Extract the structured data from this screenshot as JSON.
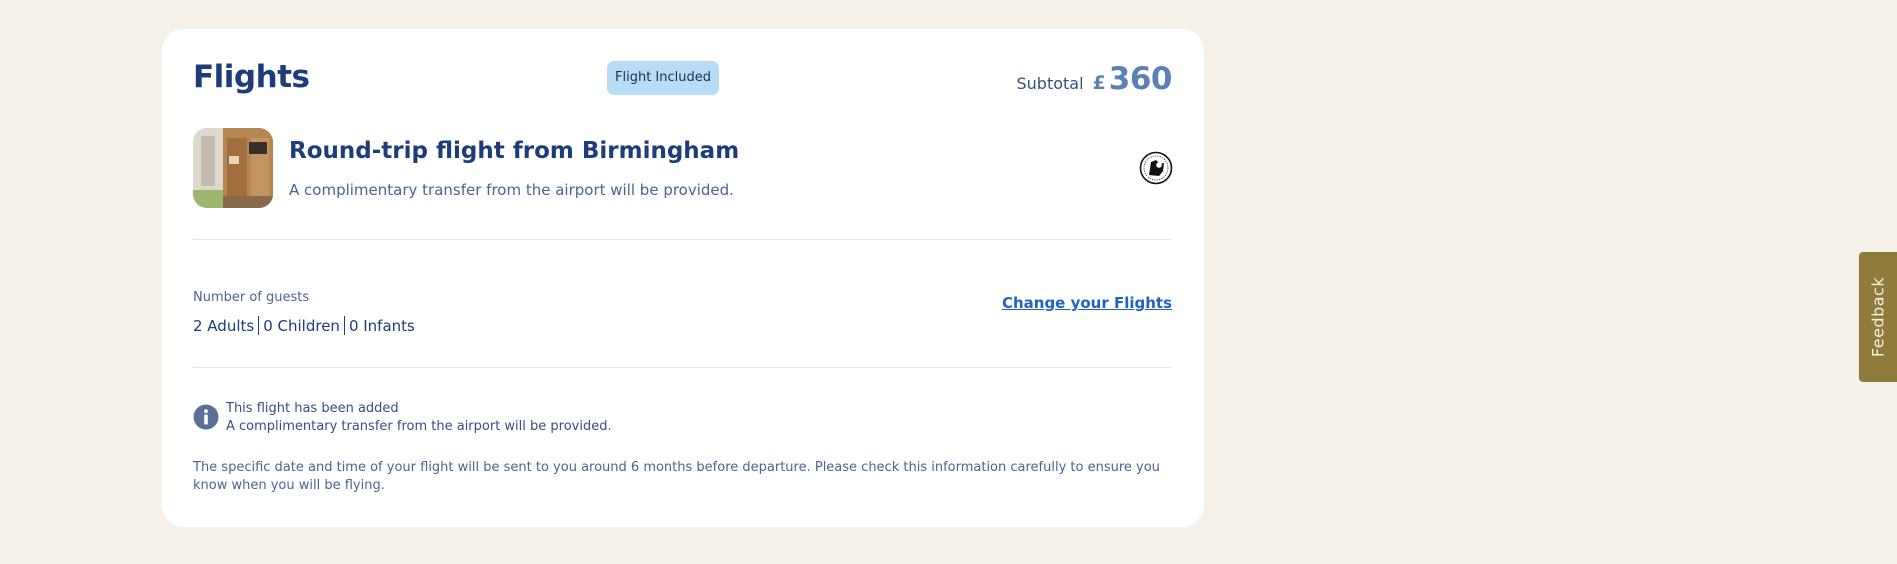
{
  "flights": {
    "title": "Flights",
    "badge": "Flight Included",
    "subtotal_label": "Subtotal",
    "currency": "£",
    "amount": "360",
    "item": {
      "thumbnail_icon": "room-photo-thumbnail",
      "title": "Round-trip flight from Birmingham",
      "description": "A complimentary transfer from the airport will be provided.",
      "seal_icon": "certification-seal-icon"
    },
    "guests": {
      "label": "Number of guests",
      "adults": "2 Adults",
      "children": "0 Children",
      "infants": "0 Infants"
    },
    "change_link": "Change your Flights",
    "info": {
      "icon": "info-icon",
      "title": "This flight has been added",
      "text": "A complimentary transfer from the airport will be provided."
    },
    "notice": "The specific date and time of your flight will be sent to you around 6 months before departure. Please check this information carefully to ensure you know when you will be flying."
  },
  "feedback": {
    "label": "Feedback"
  },
  "colors": {
    "page_background": "#f6f2ea",
    "card_background": "#ffffff",
    "heading": "#1c3c7a",
    "price": "#5a80b4",
    "badge_background": "#b9dcf6",
    "link": "#1f63c3",
    "feedback_tab": "#8f7c3c"
  }
}
